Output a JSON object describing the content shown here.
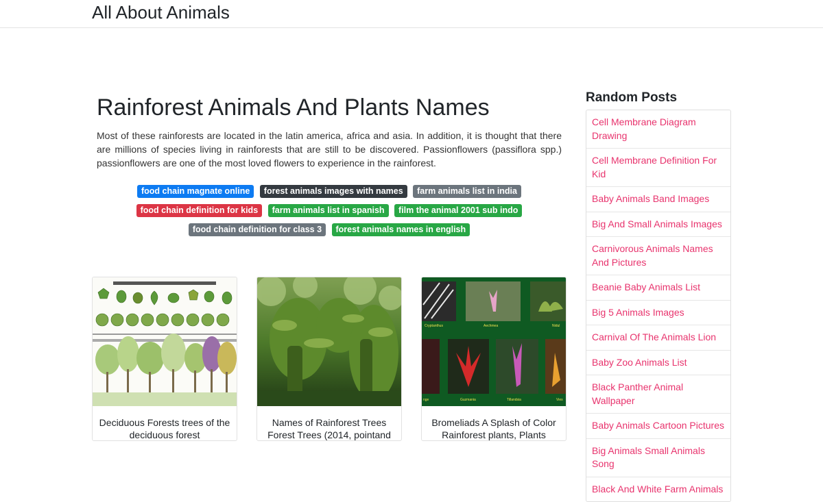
{
  "site": {
    "title": "All About Animals"
  },
  "article": {
    "title": "Rainforest Animals And Plants Names",
    "intro": "Most of these rainforests are located in the latin america, africa and asia. In addition, it is thought that there are millions of species living in rainforests that are still to be discovered. Passionflowers (passiflora spp.) passionflowers are one of the most loved flowers to experience in the rainforest.",
    "tags": [
      {
        "label": "food chain magnate online",
        "color": "#0d7bf2"
      },
      {
        "label": "forest animals images with names",
        "color": "#343a40"
      },
      {
        "label": "farm animals list in india",
        "color": "#6c757d"
      },
      {
        "label": "food chain definition for kids",
        "color": "#dc3545"
      },
      {
        "label": "farm animals list in spanish",
        "color": "#28a745"
      },
      {
        "label": "film the animal 2001 sub indo",
        "color": "#28a745"
      },
      {
        "label": "food chain definition for class 3",
        "color": "#6c757d"
      },
      {
        "label": "forest animals names in english",
        "color": "#28a745"
      }
    ]
  },
  "cards": [
    {
      "caption": "Deciduous Forests trees of the deciduous forest"
    },
    {
      "caption": "Names of Rainforest Trees Forest Trees (2014, pointand"
    },
    {
      "caption": "Bromeliads A Splash of Color Rainforest plants, Plants"
    }
  ],
  "sidebar": {
    "title": "Random Posts",
    "posts": [
      "Cell Membrane Diagram Drawing",
      "Cell Membrane Definition For Kid",
      "Baby Animals Band Images",
      "Big And Small Animals Images",
      "Carnivorous Animals Names And Pictures",
      "Beanie Baby Animals List",
      "Big 5 Animals Images",
      "Carnival Of The Animals Lion",
      "Baby Zoo Animals List",
      "Black Panther Animal Wallpaper",
      "Baby Animals Cartoon Pictures",
      "Big Animals Small Animals Song",
      "Black And White Farm Animals"
    ]
  },
  "colors": {
    "link": "#e8336d",
    "text": "#212529",
    "border": "#e3e3e3"
  }
}
